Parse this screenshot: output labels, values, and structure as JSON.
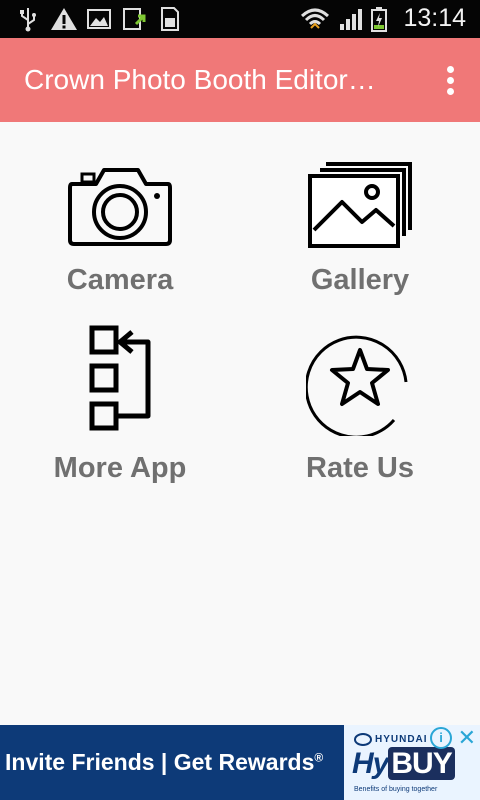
{
  "status_bar": {
    "time": "13:14",
    "icons": [
      "usb-icon",
      "warning-icon",
      "image-icon",
      "screenshot-icon",
      "sd-card-icon",
      "wifi-icon",
      "signal-icon",
      "battery-charging-icon"
    ]
  },
  "toolbar": {
    "title": "Crown Photo Booth Editor…",
    "menu_icon": "more-vert-icon",
    "background": "#f07878"
  },
  "menu": {
    "items": [
      {
        "label": "Camera",
        "icon": "camera-icon"
      },
      {
        "label": "Gallery",
        "icon": "gallery-icon"
      },
      {
        "label": "More App",
        "icon": "more-apps-icon"
      },
      {
        "label": "Rate Us",
        "icon": "star-icon"
      }
    ]
  },
  "ad": {
    "text": "Invite Friends | Get Rewards",
    "trademark": "®",
    "brand": "HYUNDAI",
    "product_prefix": "Hy",
    "product_suffix": "BUY",
    "tagline": "Benefits of buying together",
    "info_icon": "info-icon",
    "close_icon": "close-icon",
    "background": "#0d3a78"
  }
}
